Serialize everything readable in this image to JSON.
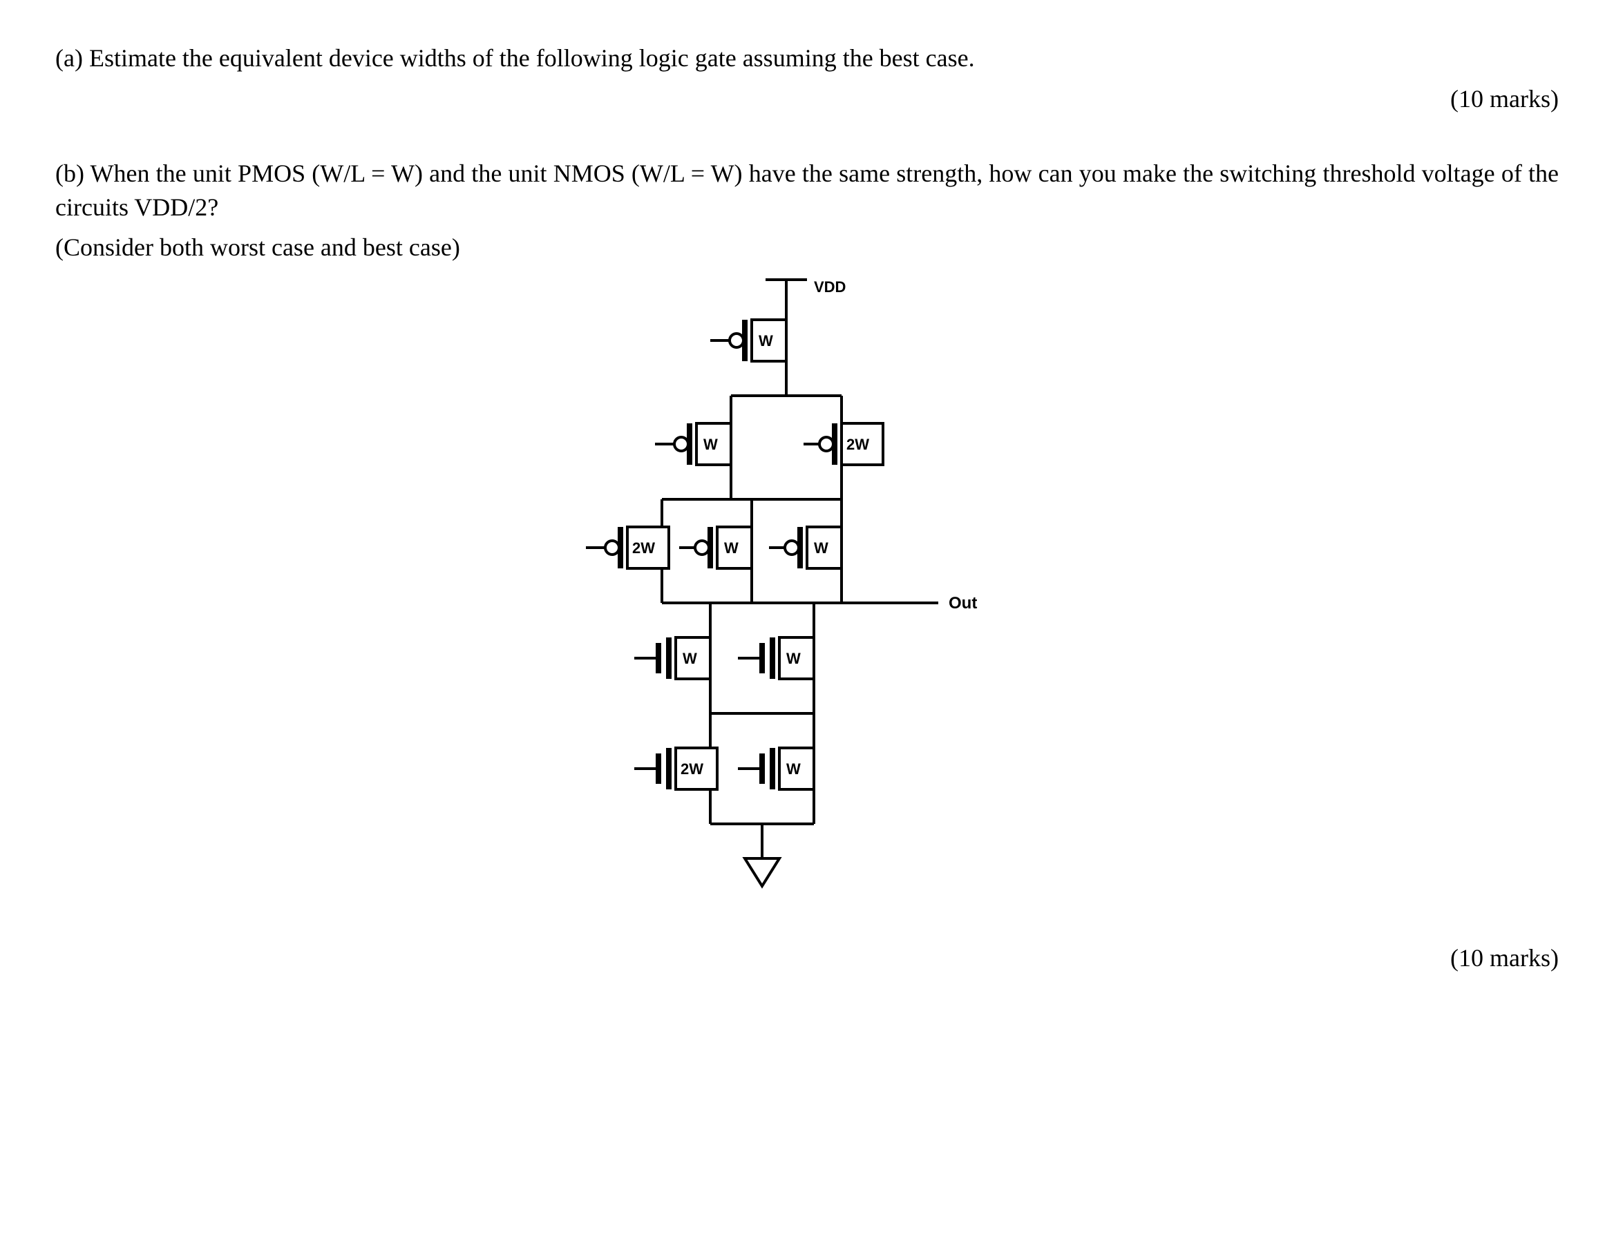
{
  "qa": {
    "text": "(a) Estimate the equivalent device widths of the following logic gate assuming the best case.",
    "marks": "(10 marks)"
  },
  "qb": {
    "line1": "(b) When the unit PMOS (W/L = W) and the unit NMOS (W/L = W) have the same strength, how can you make the switching threshold voltage of the circuits VDD/2?",
    "line2": "(Consider both worst case and best case)",
    "marks": "(10 marks)"
  },
  "circuit": {
    "vdd_label": "VDD",
    "out_label": "Out",
    "p1": "W",
    "p2a": "W",
    "p2b": "2W",
    "p3a": "2W",
    "p3b": "W",
    "p3c": "W",
    "n1a": "W",
    "n1b": "W",
    "n2a": "2W",
    "n2b": "W"
  }
}
